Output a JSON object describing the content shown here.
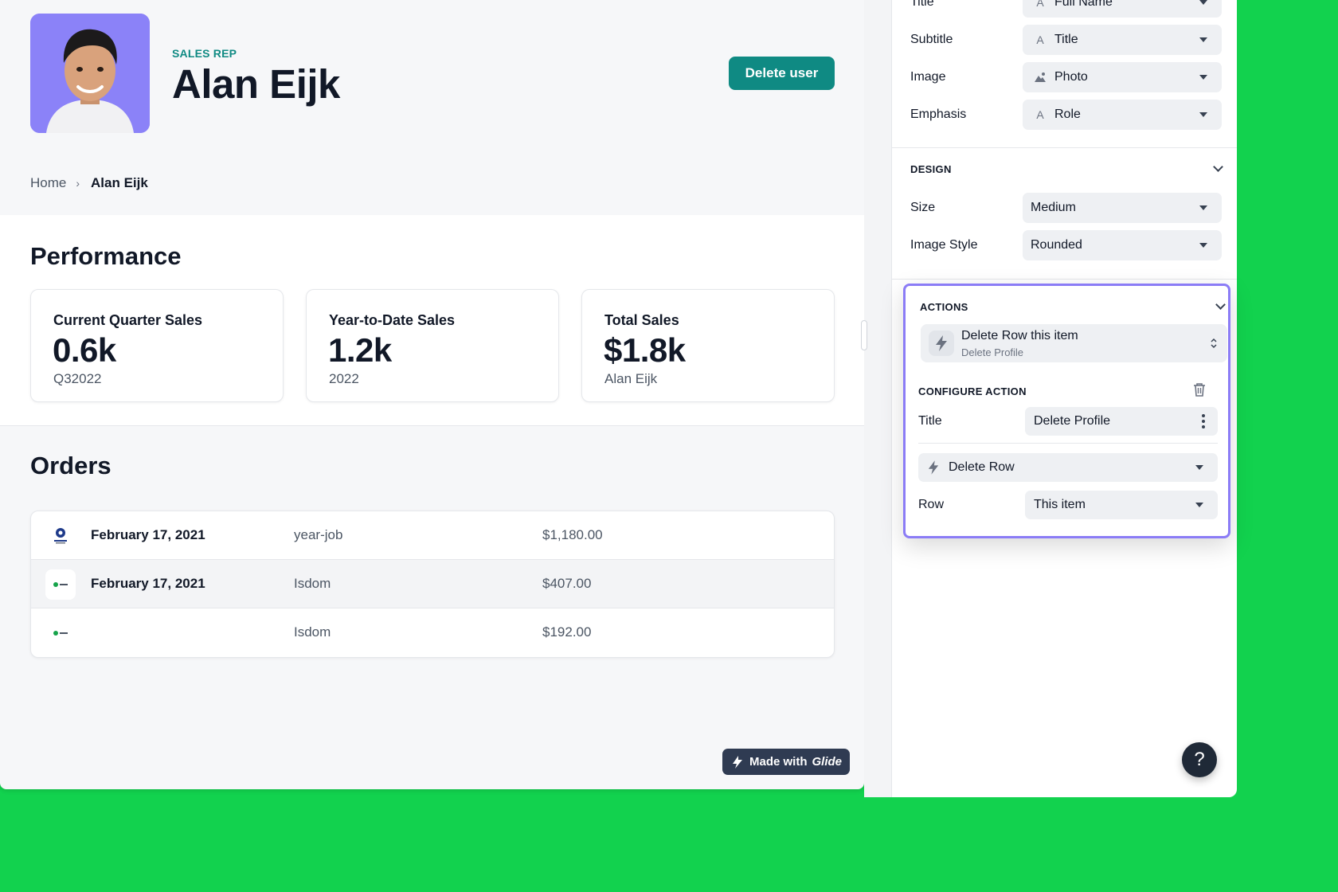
{
  "profile": {
    "eyebrow": "SALES REP",
    "name": "Alan Eijk",
    "delete_label": "Delete user"
  },
  "breadcrumb": {
    "home": "Home",
    "current": "Alan Eijk"
  },
  "performance": {
    "title": "Performance",
    "stats": [
      {
        "label": "Current Quarter Sales",
        "value": "0.6k",
        "sub": "Q32022"
      },
      {
        "label": "Year-to-Date Sales",
        "value": "1.2k",
        "sub": "2022"
      },
      {
        "label": "Total Sales",
        "value": "$1.8k",
        "sub": "Alan Eijk"
      }
    ]
  },
  "orders": {
    "title": "Orders",
    "rows": [
      {
        "date": "February 17, 2021",
        "type": "year-job",
        "amount": "$1,180.00",
        "logo": "year-job-logo"
      },
      {
        "date": "February 17, 2021",
        "type": "Isdom",
        "amount": "$407.00",
        "logo": "isdom-logo"
      },
      {
        "date": "",
        "type": "Isdom",
        "amount": "$192.00",
        "logo": "isdom-logo"
      }
    ]
  },
  "badge": {
    "made_with": "Made with",
    "brand": "Glide"
  },
  "panel": {
    "content_rows": [
      {
        "label": "Title",
        "value": "Full Name",
        "icon": "text-icon"
      },
      {
        "label": "Subtitle",
        "value": "Title",
        "icon": "text-icon"
      },
      {
        "label": "Image",
        "value": "Photo",
        "icon": "image-icon"
      },
      {
        "label": "Emphasis",
        "value": "Role",
        "icon": "text-icon"
      }
    ],
    "design": {
      "heading": "DESIGN",
      "rows": [
        {
          "label": "Size",
          "value": "Medium"
        },
        {
          "label": "Image Style",
          "value": "Rounded"
        }
      ]
    },
    "actions": {
      "heading": "ACTIONS",
      "item_title": "Delete Row this item",
      "item_sub": "Delete Profile",
      "configure": {
        "heading": "CONFIGURE ACTION",
        "title_label": "Title",
        "title_value": "Delete Profile",
        "action_value": "Delete Row",
        "row_label": "Row",
        "row_value": "This item"
      }
    },
    "help_label": "?"
  },
  "colors": {
    "background": "#12d24e",
    "accent": "#0f8a83",
    "highlight": "#8b7cf6",
    "avatar_bg": "#8b82f8"
  }
}
